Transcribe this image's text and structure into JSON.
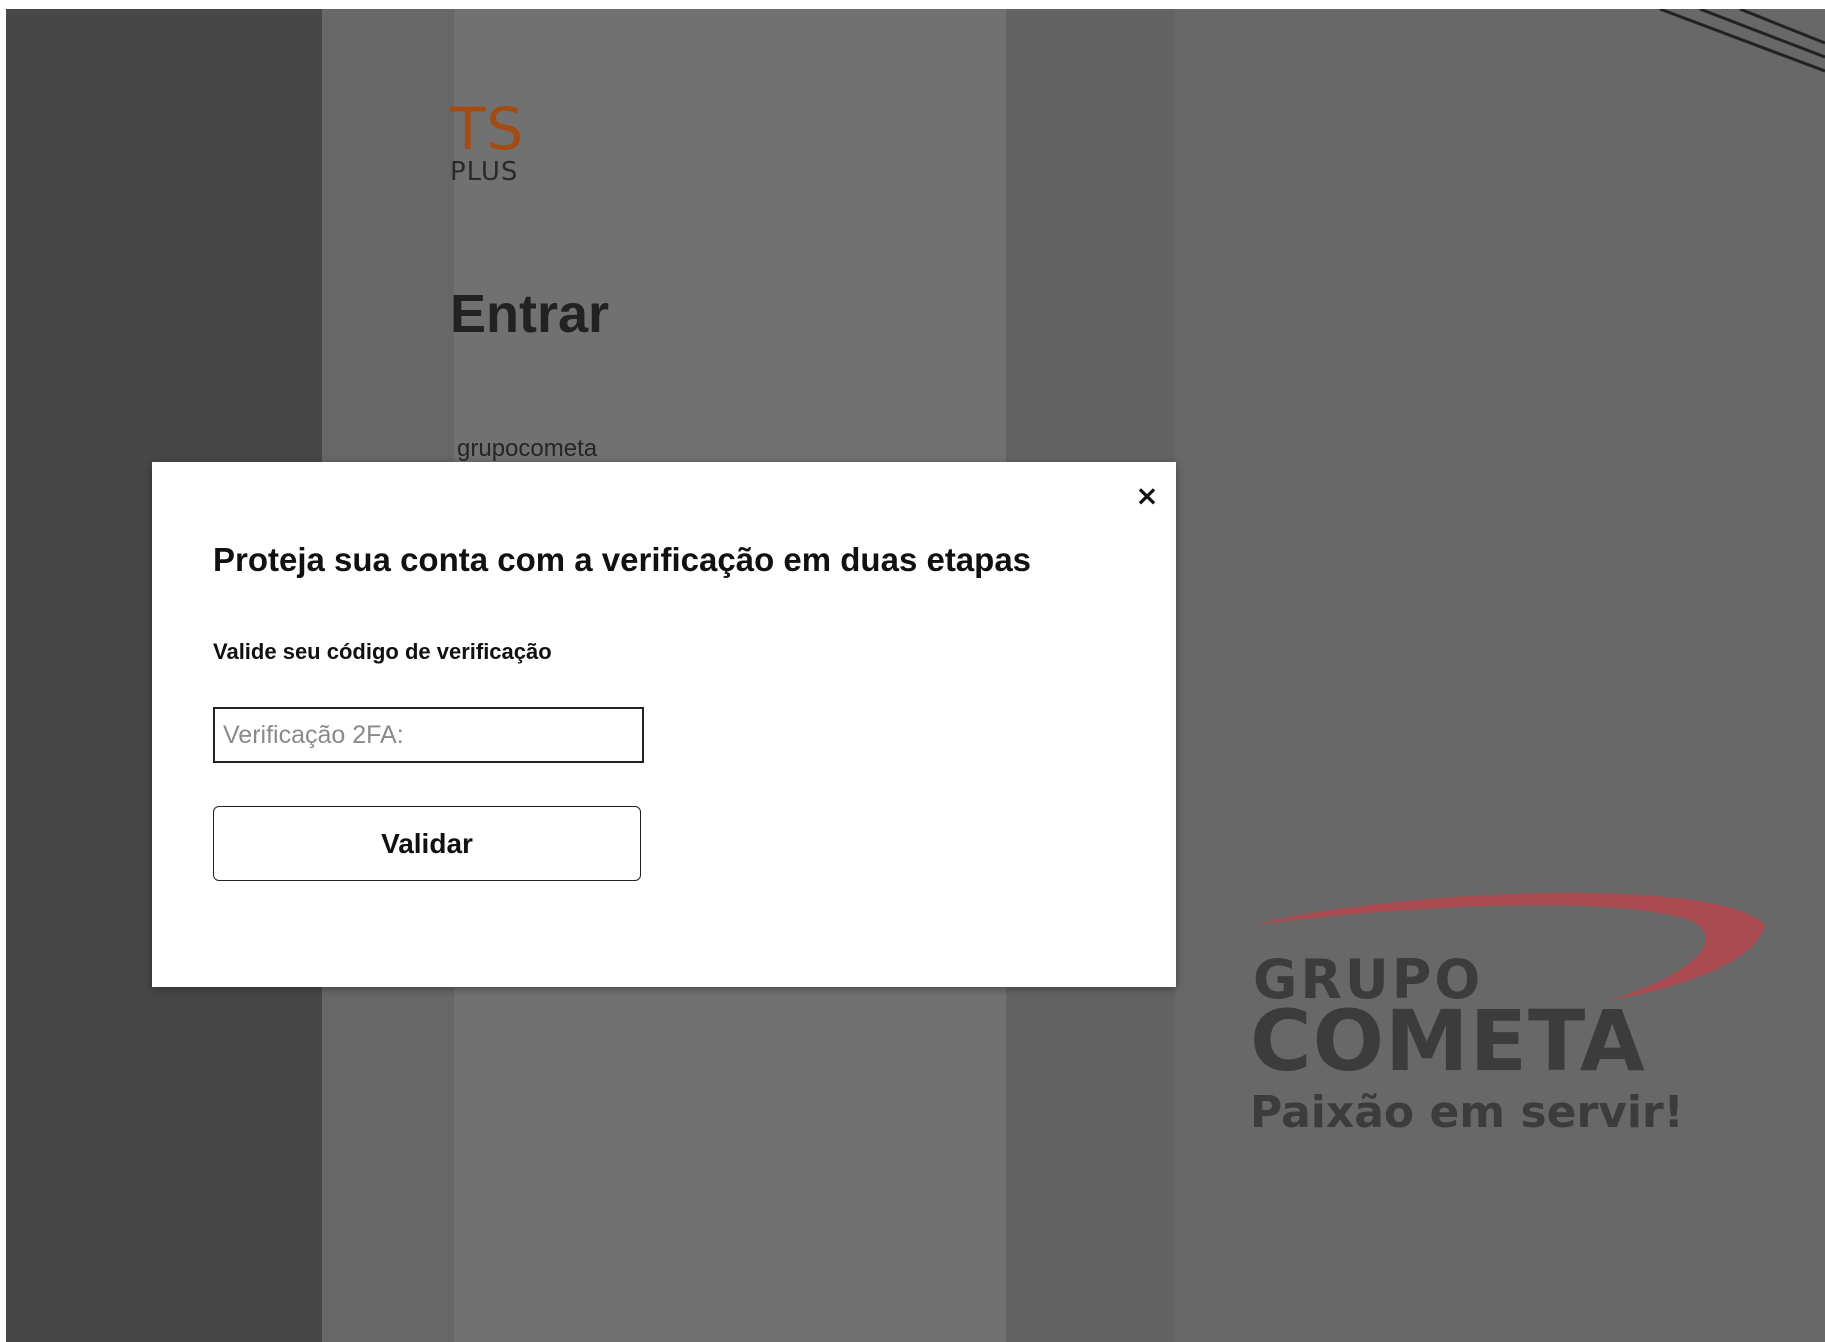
{
  "login_page": {
    "logo": {
      "top": "TS",
      "bottom": "PLUS"
    },
    "title": "Entrar",
    "username": "grupocometa",
    "brand": {
      "line1": "GRUPO",
      "line2": "COMETA",
      "tagline": "Paixão em servir!",
      "swoosh_color": "#b5474d"
    }
  },
  "modal": {
    "close_label": "×",
    "title": "Proteja sua conta com a verificação em duas etapas",
    "subtitle": "Valide seu código de verificação",
    "code_input": {
      "placeholder": "Verificação 2FA:",
      "value": ""
    },
    "validate_label": "Validar"
  },
  "colors": {
    "overlay_dark": "#474747",
    "overlay_mid": "#717171",
    "modal_bg": "#ffffff",
    "logo_orange": "#a34b12"
  }
}
